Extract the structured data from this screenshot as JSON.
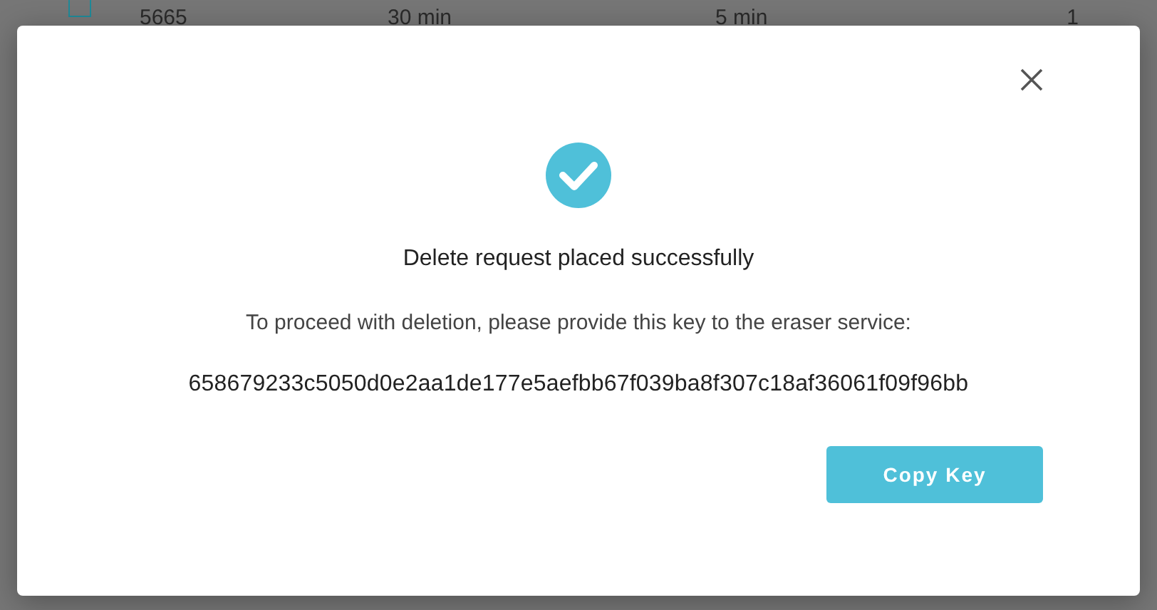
{
  "background_row": {
    "checked": false,
    "cells": [
      "5665",
      "30 min",
      "5 min",
      "1"
    ]
  },
  "dialog": {
    "title": "Delete request placed successfully",
    "message": "To proceed with deletion, please provide this key to the eraser service:",
    "key": "658679233c5050d0e2aa1de177e5aefbb67f039ba8f307c18af36061f09f96bb",
    "button": "Copy Key"
  }
}
